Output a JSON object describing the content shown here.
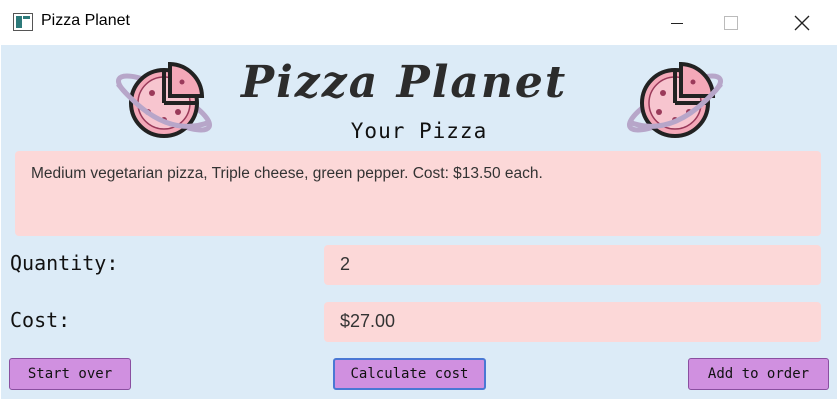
{
  "window": {
    "title": "Pizza Planet"
  },
  "header": {
    "logo_text": "Pizza Planet",
    "subtitle": "Your Pizza"
  },
  "order": {
    "description": "Medium vegetarian pizza, Triple cheese, green pepper. Cost: $13.50 each."
  },
  "form": {
    "quantity_label": "Quantity:",
    "quantity_value": "2",
    "cost_label": "Cost:",
    "cost_value": "$27.00"
  },
  "buttons": {
    "start_over": "Start over",
    "calculate": "Calculate cost",
    "add_to_order": "Add to order"
  },
  "colors": {
    "background": "#dcebf7",
    "field_background": "#fcd8d8",
    "button": "#d090e0",
    "button_border": "#8a4fa0",
    "focus_border": "#4a78d4",
    "planet_ring": "#b7a6c9",
    "pizza_pink": "#f7c5cf"
  },
  "icons": {
    "app": "app-window-icon",
    "minimize": "minimize-icon",
    "maximize": "maximize-icon",
    "close": "close-icon",
    "logo_left": "pizza-planet-logo-icon",
    "logo_right": "pizza-planet-logo-icon"
  }
}
